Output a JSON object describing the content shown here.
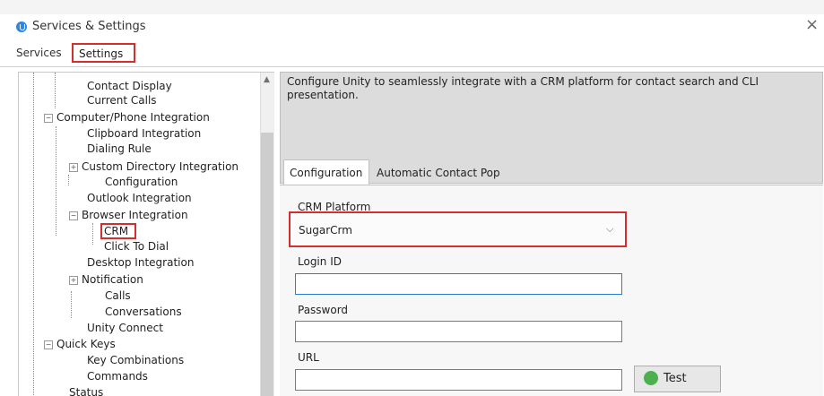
{
  "window": {
    "title": "Services & Settings",
    "close_glyph": "×"
  },
  "top_tabs": {
    "services": "Services",
    "settings": "Settings"
  },
  "tree": {
    "items": [
      "Contact Display",
      "Current Calls",
      "Computer/Phone Integration",
      "Clipboard Integration",
      "Dialing Rule",
      "Custom Directory Integration",
      "Configuration",
      "Outlook Integration",
      "Browser Integration",
      "CRM",
      "Click To Dial",
      "Desktop Integration",
      "Notification",
      "Calls",
      "Conversations",
      "Unity Connect",
      "Quick Keys",
      "Key Combinations",
      "Commands",
      "Status"
    ],
    "expanders": {
      "collapse": "−",
      "expand": "+"
    }
  },
  "description": "Configure Unity to seamlessly integrate with a CRM platform for contact search and CLI presentation.",
  "config_tabs": {
    "configuration": "Configuration",
    "automatic_contact_pop": "Automatic Contact Pop"
  },
  "form": {
    "crm_platform_label": "CRM Platform",
    "crm_platform_value": "SugarCrm",
    "login_id_label": "Login ID",
    "login_id_value": "",
    "password_label": "Password",
    "password_value": "",
    "url_label": "URL",
    "url_value": "",
    "test_button": "Test"
  },
  "colors": {
    "highlight": "#d32f2f",
    "description_bg": "#dcdcdc",
    "focus_border": "#2b7cd3"
  },
  "icons": {
    "app": "unity-app-icon",
    "test": "test-connection-icon",
    "dropdown": "chevron-down-icon",
    "close": "close-icon"
  }
}
